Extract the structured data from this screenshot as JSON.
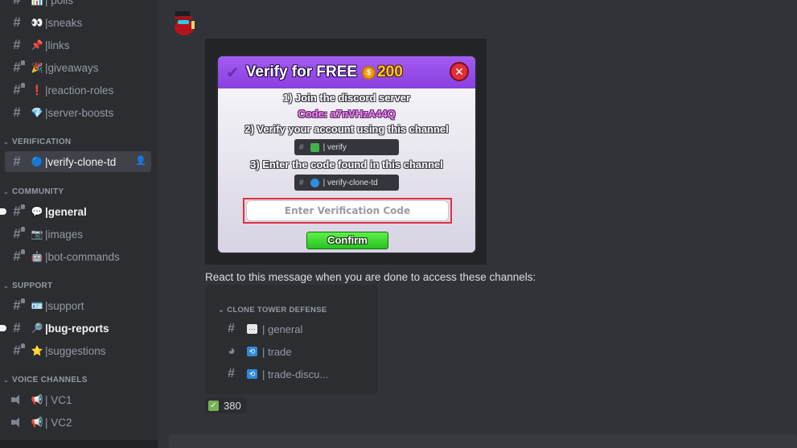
{
  "sidebar": {
    "channels_top": [
      {
        "emoji": "📊",
        "label": "| polls",
        "locked": false
      },
      {
        "emoji": "👀",
        "label": "|sneaks",
        "locked": false
      },
      {
        "emoji": "📌",
        "label": "|links",
        "locked": false
      },
      {
        "emoji": "🎉",
        "label": "|giveaways",
        "locked": true
      },
      {
        "emoji": "❗",
        "label": "|reaction-roles",
        "locked": true
      },
      {
        "emoji": "💎",
        "label": "|server-boosts",
        "locked": false
      }
    ],
    "categories": [
      {
        "name": "VERIFICATION",
        "channels": [
          {
            "emoji": "🔵",
            "label": "|verify-clone-td",
            "active": true,
            "locked": false
          }
        ]
      },
      {
        "name": "COMMUNITY",
        "channels": [
          {
            "emoji": "💬",
            "label": "|general",
            "unread": true,
            "locked": true
          },
          {
            "emoji": "📷",
            "label": "|images",
            "locked": true
          },
          {
            "emoji": "🤖",
            "label": "|bot-commands",
            "locked": true
          }
        ]
      },
      {
        "name": "SUPPORT",
        "channels": [
          {
            "emoji": "🪪",
            "label": "|support",
            "locked": true
          },
          {
            "emoji": "🔎",
            "label": "|bug-reports",
            "unread": true,
            "locked": false
          },
          {
            "emoji": "⭐",
            "label": "|suggestions",
            "locked": true
          }
        ]
      },
      {
        "name": "VOICE CHANNELS",
        "channels": [
          {
            "emoji": "📢",
            "label": "| VC1",
            "voice": true
          },
          {
            "emoji": "📢",
            "label": "| VC2",
            "voice": true
          }
        ]
      }
    ],
    "invite_icon": "create-invite-icon"
  },
  "message": {
    "game_card": {
      "title": "Verify for FREE",
      "price": "200",
      "close_label": "✕",
      "step1": "1) Join the discord server",
      "code": "Code: a7nVHzA44Q",
      "step2": "2) Verify your account using this channel",
      "channel1": "| verify",
      "step3": "3) Enter the code found in this channel",
      "channel2": "| verify-clone-td",
      "input_placeholder": "Enter Verification Code",
      "confirm_label": "Confirm"
    },
    "react_text": "React to this message when you are done to access these channels:",
    "channel_embed": {
      "category": "CLONE TOWER DEFENSE",
      "channels": [
        {
          "emoji": "💬",
          "label": "| general",
          "type": "text"
        },
        {
          "emoji": "🔁",
          "label": "| trade",
          "type": "forum"
        },
        {
          "emoji": "🔁",
          "label": "| trade-discu...",
          "type": "text"
        }
      ]
    },
    "reaction": {
      "emoji": "✅",
      "count": "380"
    }
  },
  "colors": {
    "sidebar_bg": "#2b2d31",
    "main_bg": "#313338",
    "card_header": "#9b51ee",
    "confirm_green": "#3fd835",
    "close_red": "#e0303a",
    "code_pink": "#e28ae8"
  }
}
